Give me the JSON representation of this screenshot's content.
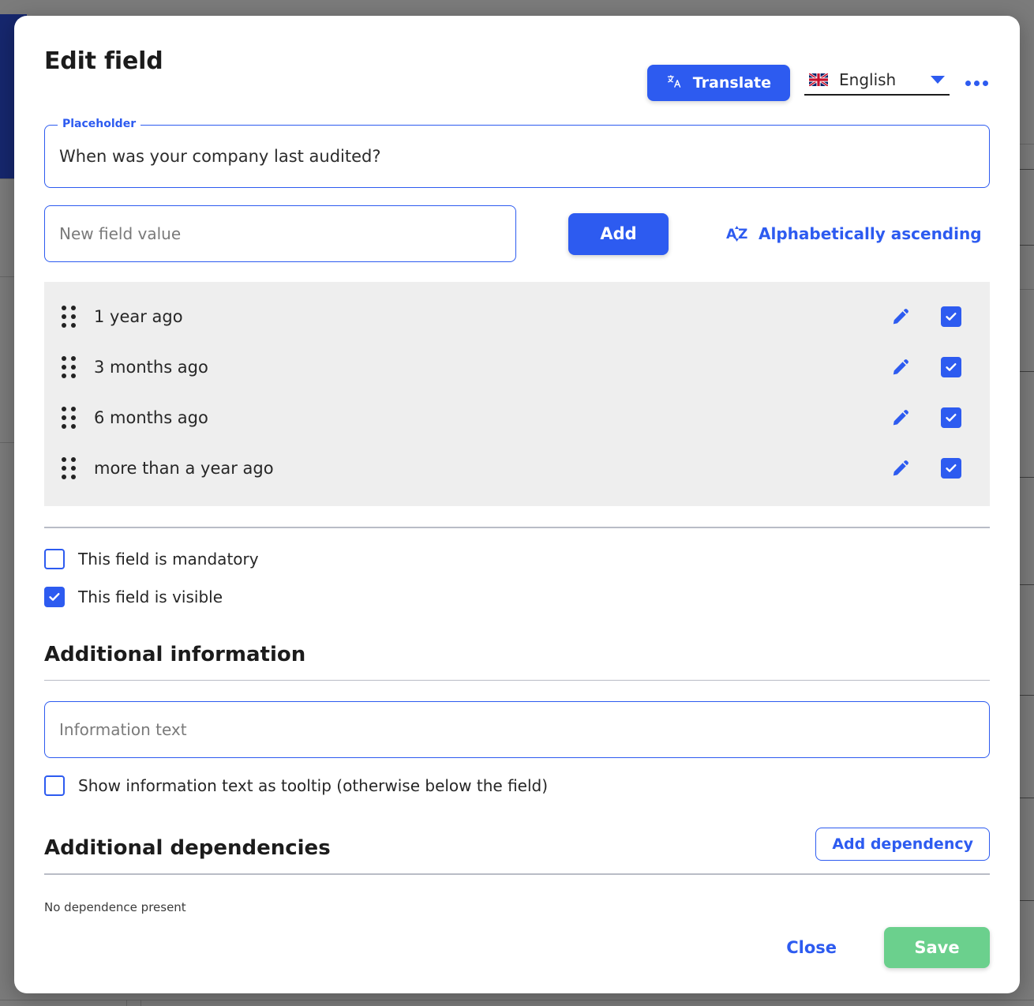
{
  "modal": {
    "title": "Edit field",
    "header": {
      "translate_button": "Translate",
      "translate_icon": "translate-icon",
      "language": "English",
      "flag_icon": "uk-flag-icon",
      "dropdown_icon": "chevron-down-icon",
      "more_icon": "kebab-menu-icon"
    },
    "placeholder_field": {
      "legend": "Placeholder",
      "value": "When was your company last audited?"
    },
    "add_value": {
      "input_placeholder": "New field value",
      "input_value": "",
      "add_label": "Add",
      "sort_label": "Alphabetically ascending",
      "sort_icon": "sort-alpha-ascending-icon"
    },
    "options": [
      {
        "label": "1 year ago",
        "edit_icon": "pencil-icon",
        "checked": true
      },
      {
        "label": "3 months ago",
        "edit_icon": "pencil-icon",
        "checked": true
      },
      {
        "label": "6 months ago",
        "edit_icon": "pencil-icon",
        "checked": true
      },
      {
        "label": "more than a year ago",
        "edit_icon": "pencil-icon",
        "checked": true
      }
    ],
    "toggles": {
      "mandatory_label": "This field is mandatory",
      "mandatory_checked": false,
      "visible_label": "This field is visible",
      "visible_checked": true
    },
    "additional_information": {
      "heading": "Additional information",
      "input_placeholder": "Information text",
      "input_value": "",
      "tooltip_label": "Show information text as tooltip (otherwise below the field)",
      "tooltip_checked": false
    },
    "additional_dependencies": {
      "heading": "Additional dependencies",
      "add_label": "Add dependency",
      "empty_text": "No dependence present"
    },
    "footer": {
      "close_label": "Close",
      "save_label": "Save"
    }
  },
  "colors": {
    "primary_blue": "#2d5bf0",
    "save_green": "#6bd08d",
    "list_bg": "#eeeeee",
    "sidebar_navy": "#16276e",
    "overlay_gray": "#7b7b7b"
  }
}
